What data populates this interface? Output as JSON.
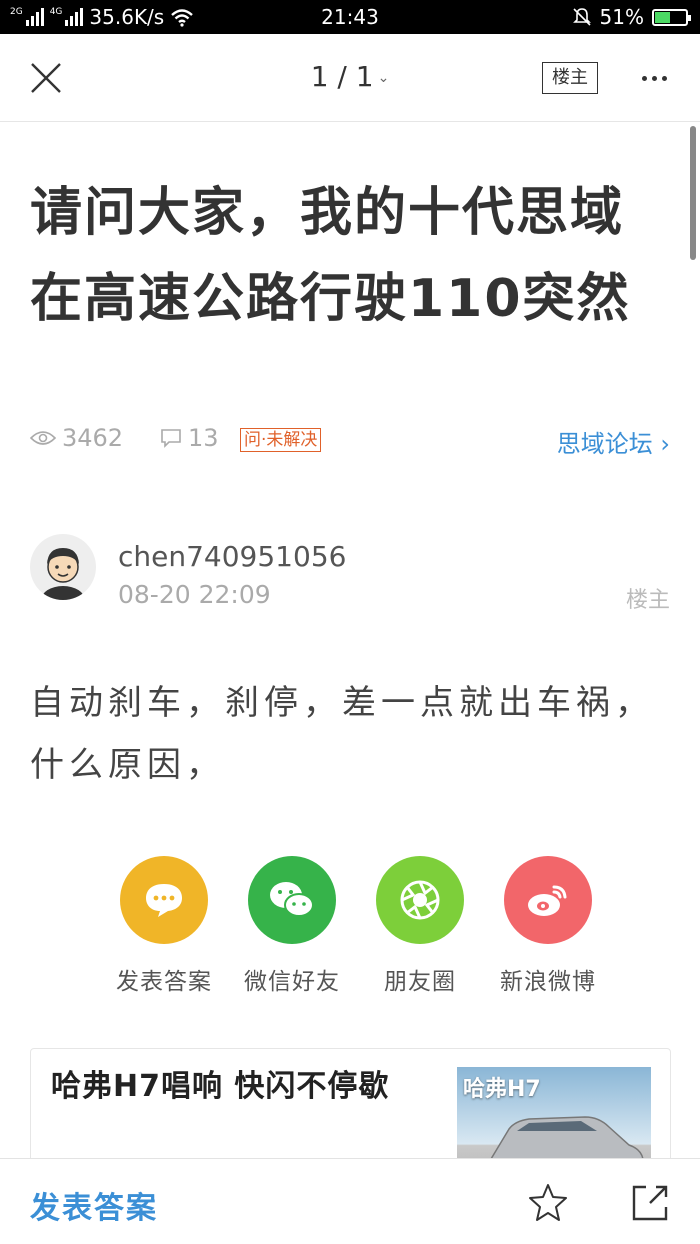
{
  "status_bar": {
    "net_speed": "35.6K/s",
    "time": "21:43",
    "battery": "51%",
    "battery_level": 0.51,
    "sim1": "2G",
    "sim2": "4G"
  },
  "nav": {
    "page_indicator": "1 / 1",
    "op_button": "楼主",
    "icons": [
      "close-icon",
      "chevron-down-icon",
      "more-icon"
    ]
  },
  "post": {
    "title": "请问大家，我的十代思域在高速公路行驶110突然",
    "views": "3462",
    "comments": "13",
    "status_badge": "问·未解决",
    "forum": "思域论坛",
    "author": "chen740951056",
    "time": "08-20 22:09",
    "floor": "楼主",
    "body": "自动刹车，刹停，差一点就出车祸，什么原因，"
  },
  "share": {
    "items": [
      {
        "label": "发表答案",
        "color": "#F0B528",
        "icon": "comment-icon"
      },
      {
        "label": "微信好友",
        "color": "#36B34A",
        "icon": "wechat-icon"
      },
      {
        "label": "朋友圈",
        "color": "#7DCF3A",
        "icon": "moments-icon"
      },
      {
        "label": "新浪微博",
        "color": "#F2666A",
        "icon": "weibo-icon"
      }
    ]
  },
  "ad": {
    "title": "哈弗H7唱响 快闪不停歇",
    "thumb_label": "哈弗H7"
  },
  "bottom_bar": {
    "answer": "发表答案",
    "icons": [
      "star-icon",
      "share-icon"
    ]
  },
  "colors": {
    "accent_blue": "#3B8FD6",
    "badge_orange": "#E0612A"
  }
}
